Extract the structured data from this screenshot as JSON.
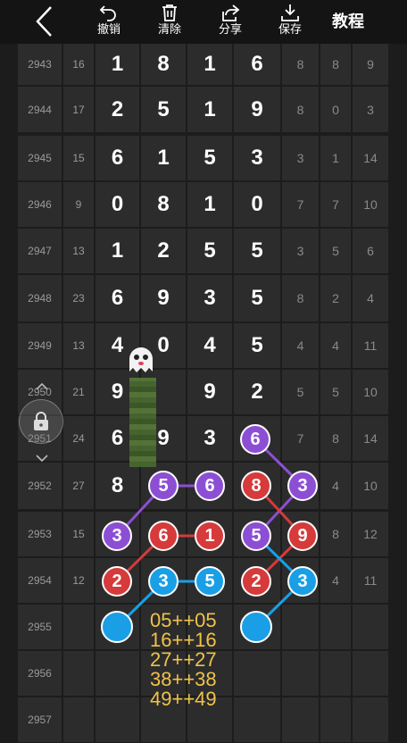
{
  "toolbar": {
    "undo": "撤销",
    "clear": "清除",
    "share": "分享",
    "save": "保存",
    "tutorial": "教程"
  },
  "rows": [
    {
      "issue": "2943",
      "sum": "16",
      "d": [
        "1",
        "8",
        "1",
        "6"
      ],
      "s": [
        "8",
        "8",
        "9"
      ]
    },
    {
      "issue": "2944",
      "sum": "17",
      "d": [
        "2",
        "5",
        "1",
        "9"
      ],
      "s": [
        "8",
        "0",
        "3"
      ]
    },
    {
      "issue": "2945",
      "sum": "15",
      "d": [
        "6",
        "1",
        "5",
        "3"
      ],
      "s": [
        "3",
        "1",
        "14"
      ]
    },
    {
      "issue": "2946",
      "sum": "9",
      "d": [
        "0",
        "8",
        "1",
        "0"
      ],
      "s": [
        "7",
        "7",
        "10"
      ]
    },
    {
      "issue": "2947",
      "sum": "13",
      "d": [
        "1",
        "2",
        "5",
        "5"
      ],
      "s": [
        "3",
        "5",
        "6"
      ]
    },
    {
      "issue": "2948",
      "sum": "23",
      "d": [
        "6",
        "9",
        "3",
        "5"
      ],
      "s": [
        "8",
        "2",
        "4"
      ]
    },
    {
      "issue": "2949",
      "sum": "13",
      "d": [
        "4",
        "0",
        "4",
        "5"
      ],
      "s": [
        "4",
        "4",
        "11"
      ]
    },
    {
      "issue": "2950",
      "sum": "21",
      "d": [
        "9",
        "",
        "9",
        "2"
      ],
      "s": [
        "5",
        "5",
        "10"
      ]
    },
    {
      "issue": "2951",
      "sum": "24",
      "d": [
        "6",
        "9",
        "3",
        ""
      ],
      "s": [
        "7",
        "8",
        "14"
      ]
    },
    {
      "issue": "2952",
      "sum": "27",
      "d": [
        "8",
        "",
        "",
        ""
      ],
      "s": [
        "",
        "4",
        "10"
      ]
    },
    {
      "issue": "2953",
      "sum": "15",
      "d": [
        "",
        "",
        "",
        ""
      ],
      "s": [
        "",
        "8",
        "12"
      ]
    },
    {
      "issue": "2954",
      "sum": "12",
      "d": [
        "",
        "",
        "",
        ""
      ],
      "s": [
        "",
        "4",
        "11"
      ]
    },
    {
      "issue": "2955",
      "sum": "",
      "d": [
        "",
        "",
        "",
        ""
      ],
      "s": [
        "",
        "",
        ""
      ]
    },
    {
      "issue": "2956",
      "sum": "",
      "d": [
        "",
        "",
        "",
        ""
      ],
      "s": [
        "",
        "",
        ""
      ]
    },
    {
      "issue": "2957",
      "sum": "",
      "d": [
        "",
        "",
        "",
        ""
      ],
      "s": [
        "",
        "",
        ""
      ]
    }
  ],
  "balls": [
    {
      "n": "6",
      "c": "purple"
    },
    {
      "n": "5",
      "c": "purple"
    },
    {
      "n": "6",
      "c": "purple"
    },
    {
      "n": "8",
      "c": "red"
    },
    {
      "n": "3",
      "c": "purple"
    },
    {
      "n": "3",
      "c": "purple"
    },
    {
      "n": "6",
      "c": "red"
    },
    {
      "n": "1",
      "c": "red"
    },
    {
      "n": "5",
      "c": "purple"
    },
    {
      "n": "9",
      "c": "red"
    },
    {
      "n": "2",
      "c": "red"
    },
    {
      "n": "3",
      "c": "blue"
    },
    {
      "n": "5",
      "c": "blue"
    },
    {
      "n": "2",
      "c": "red"
    },
    {
      "n": "3",
      "c": "blue"
    },
    {
      "n": "",
      "c": "blue"
    },
    {
      "n": "",
      "c": "blue"
    }
  ],
  "formula": [
    "05++05",
    "16++16",
    "27++27",
    "38++38",
    "49++49"
  ],
  "colors": {
    "purple": "#8c4fd4",
    "red": "#d63a3a",
    "blue": "#1a9fe6",
    "formula": "#f0c24a"
  }
}
